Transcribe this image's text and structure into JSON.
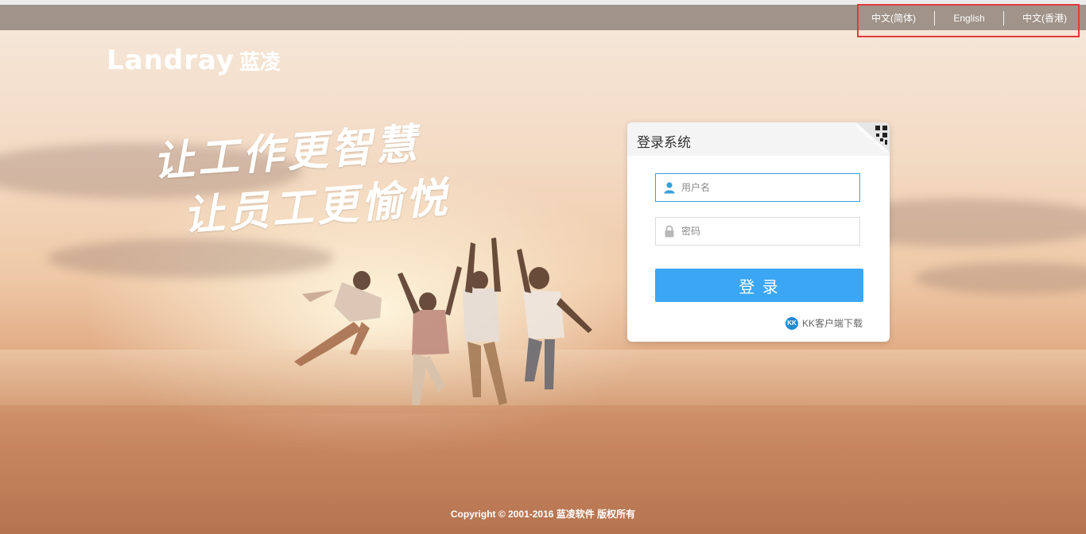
{
  "languages": [
    {
      "label": "中文(简体)"
    },
    {
      "label": "English"
    },
    {
      "label": "中文(香港)"
    }
  ],
  "logo": {
    "en": "Landray",
    "cn": "蓝凌"
  },
  "slogan": {
    "line1": "让工作更智慧",
    "line2": "让员工更愉悦"
  },
  "login": {
    "title": "登录系统",
    "username_placeholder": "用户名",
    "password_placeholder": "密码",
    "submit_label": "登 录",
    "kk_icon_text": "KK",
    "kk_download_label": "KK客户端下载"
  },
  "footer": {
    "copyright": "Copyright © 2001-2016 蓝凌软件 版权所有"
  },
  "colors": {
    "accent": "#3aa6f4",
    "highlight_border": "#e23b3b",
    "topbar": "#8c8078"
  },
  "icons": [
    "user-icon",
    "lock-icon",
    "qr-code-icon",
    "kk-client-icon"
  ]
}
